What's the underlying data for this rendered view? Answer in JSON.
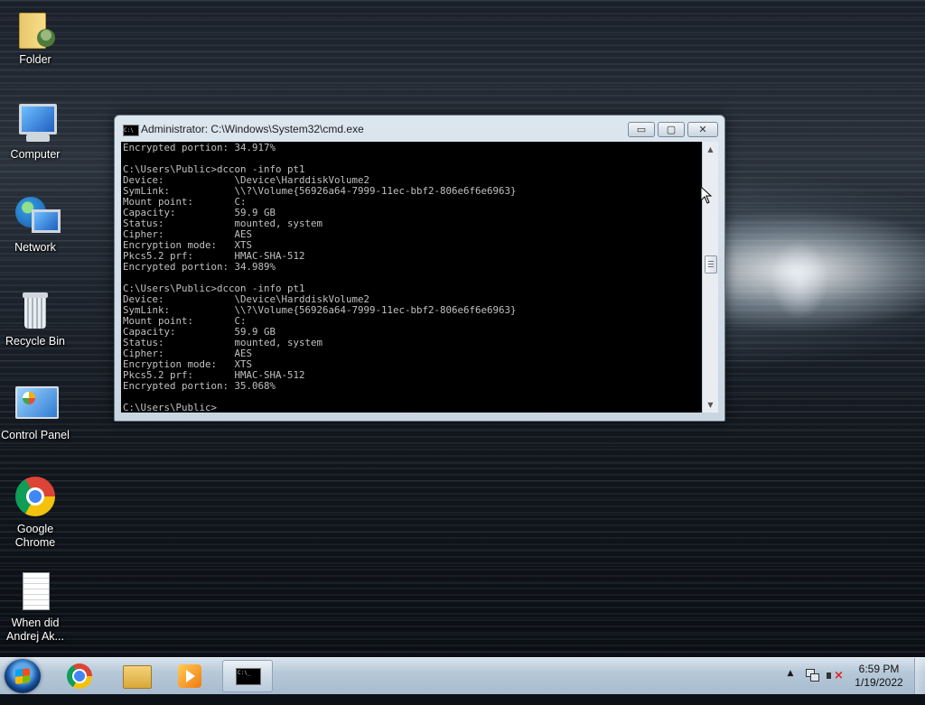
{
  "desktop": {
    "icons": [
      {
        "id": "folder",
        "label_1": "Folder",
        "label_2": ""
      },
      {
        "id": "computer",
        "label_1": "Computer",
        "label_2": ""
      },
      {
        "id": "network",
        "label_1": "Network",
        "label_2": ""
      },
      {
        "id": "recycle",
        "label_1": "Recycle Bin",
        "label_2": ""
      },
      {
        "id": "control",
        "label_1": "Control Panel",
        "label_2": ""
      },
      {
        "id": "chrome",
        "label_1": "Google",
        "label_2": "Chrome"
      },
      {
        "id": "file",
        "label_1": "When did",
        "label_2": "Andrej Ak..."
      }
    ]
  },
  "window": {
    "title": "Administrator: C:\\Windows\\System32\\cmd.exe",
    "icon_text": "C:\\",
    "buttons": {
      "minimize": "▭",
      "maximize": "▢",
      "close": "✕"
    },
    "console_text": "Encrypted portion: 34.917%\n\nC:\\Users\\Public>dccon -info pt1\nDevice:            \\Device\\HarddiskVolume2\nSymLink:           \\\\?\\Volume{56926a64-7999-11ec-bbf2-806e6f6e6963}\nMount point:       C:\nCapacity:          59.9 GB\nStatus:            mounted, system\nCipher:            AES\nEncryption mode:   XTS\nPkcs5.2 prf:       HMAC-SHA-512\nEncrypted portion: 34.989%\n\nC:\\Users\\Public>dccon -info pt1\nDevice:            \\Device\\HarddiskVolume2\nSymLink:           \\\\?\\Volume{56926a64-7999-11ec-bbf2-806e6f6e6963}\nMount point:       C:\nCapacity:          59.9 GB\nStatus:            mounted, system\nCipher:            AES\nEncryption mode:   XTS\nPkcs5.2 prf:       HMAC-SHA-512\nEncrypted portion: 35.068%\n\nC:\\Users\\Public>",
    "scroll_up": "▲",
    "scroll_down": "▼"
  },
  "taskbar": {
    "pinned": [
      "start-button",
      "chrome",
      "windows-explorer",
      "media-player",
      "command-prompt"
    ],
    "tray_arrow": "▲",
    "clock": {
      "time": "6:59 PM",
      "date": "1/19/2022"
    }
  }
}
